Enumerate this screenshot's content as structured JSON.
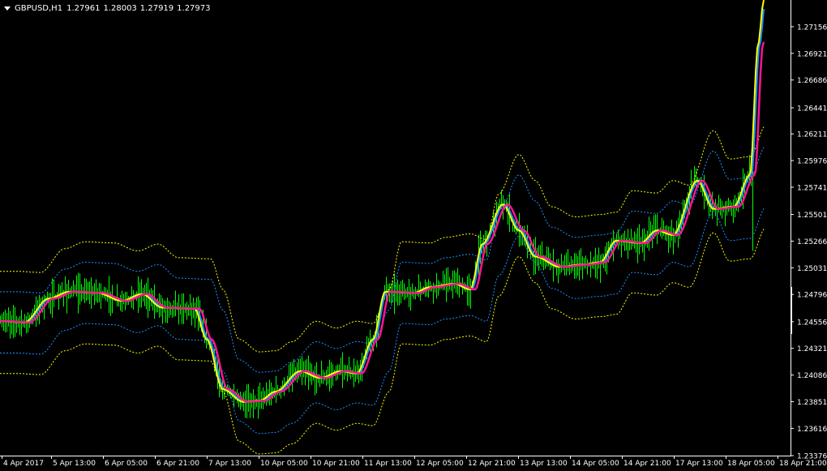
{
  "header": {
    "symbol": "GBPUSD,H1",
    "open": "1.27961",
    "high": "1.28003",
    "low": "1.27919",
    "close": "1.27973"
  },
  "colors": {
    "background": "#000000",
    "axis": "#ffffff",
    "candles": "#00ff00",
    "ma_cyan": "#1e90ff",
    "ma_yellow": "#ffff00",
    "ma_magenta": "#ff1493",
    "band_yellow": "#ffff00",
    "band_blue": "#1e90ff"
  },
  "chart_data": {
    "type": "line",
    "title": "",
    "xlabel": "",
    "ylabel": "",
    "ylim": [
      1.23376,
      1.27391
    ],
    "y_ticks": [
      "1.27156",
      "1.26921",
      "1.26686",
      "1.26441",
      "1.26211",
      "1.25976",
      "1.25741",
      "1.25501",
      "1.25266",
      "1.25031",
      "1.24796",
      "1.24556",
      "1.24321",
      "1.24086",
      "1.23851",
      "1.23616",
      "1.23376"
    ],
    "x_ticks": [
      "4 Apr 2017",
      "5 Apr 13:00",
      "6 Apr 05:00",
      "6 Apr 21:00",
      "7 Apr 13:00",
      "10 Apr 05:00",
      "10 Apr 21:00",
      "11 Apr 13:00",
      "12 Apr 05:00",
      "12 Apr 21:00",
      "13 Apr 13:00",
      "14 Apr 05:00",
      "14 Apr 21:00",
      "17 Apr 13:00",
      "18 Apr 05:00",
      "18 Apr 21:00"
    ],
    "x": [
      0,
      1,
      2,
      3,
      4,
      5,
      6,
      7,
      8,
      9,
      10,
      11,
      12,
      13,
      14,
      15,
      16,
      17,
      18,
      19,
      20,
      21,
      22,
      23,
      24,
      25,
      26,
      27,
      28,
      29,
      30,
      31,
      32,
      33,
      34,
      35,
      36,
      37,
      38,
      39,
      40,
      41,
      42,
      43,
      44,
      45,
      46,
      47,
      48,
      49,
      50,
      51,
      52,
      53,
      54,
      55,
      56,
      57,
      58,
      59,
      60,
      61,
      62,
      63,
      64,
      65,
      66,
      67,
      68,
      69,
      70,
      71,
      72,
      73,
      74,
      75,
      76,
      77,
      78,
      79,
      80,
      81,
      82,
      83,
      84,
      85,
      86,
      87,
      88,
      89,
      90,
      91,
      92,
      93,
      94,
      95,
      96,
      97,
      98,
      99,
      100,
      101,
      102,
      103,
      104,
      105,
      106,
      107,
      108,
      109,
      110,
      111,
      112,
      113,
      114,
      115,
      116,
      117,
      118,
      119,
      120,
      121,
      122,
      123,
      124,
      125,
      126,
      127,
      128,
      129,
      130,
      131,
      132,
      133,
      134,
      135,
      136,
      137,
      138,
      139,
      140,
      141,
      142,
      143,
      144,
      145,
      146,
      147,
      148,
      149,
      150,
      151,
      152,
      153,
      154,
      155,
      156,
      157,
      158,
      159,
      160,
      161,
      162,
      163,
      164,
      165,
      166,
      167,
      168,
      169,
      170,
      171,
      172,
      173,
      174,
      175,
      176,
      177,
      178,
      179,
      180,
      181,
      182,
      183,
      184,
      185,
      186,
      187,
      188,
      189,
      190,
      191,
      192,
      193,
      194,
      195,
      196,
      197,
      198,
      199,
      200,
      201,
      202,
      203,
      204,
      205,
      206,
      207,
      208,
      209,
      210,
      211,
      212,
      213,
      214,
      215,
      216,
      217,
      218,
      219,
      220,
      221,
      222,
      223,
      224,
      225,
      226,
      227,
      228,
      229,
      230,
      231,
      232,
      233,
      234,
      235,
      236,
      237,
      238,
      239,
      240,
      241,
      242,
      243,
      244,
      245,
      246,
      247,
      248,
      249,
      250,
      251,
      252,
      253,
      254,
      255,
      256,
      257,
      258,
      259,
      260,
      261,
      262,
      263,
      264,
      265,
      266,
      267,
      268,
      269,
      270,
      271,
      272,
      273,
      274,
      275,
      276,
      277,
      278,
      279,
      280,
      281,
      282,
      283,
      284,
      285,
      286,
      287,
      288,
      289,
      290,
      291,
      292,
      293,
      294,
      295,
      296,
      297,
      298,
      299,
      300,
      301,
      302,
      303,
      304,
      305,
      306,
      307,
      308,
      309,
      310,
      311,
      312,
      313,
      314,
      315,
      316,
      317,
      318,
      319,
      320,
      321,
      322,
      323,
      324,
      325,
      326,
      327,
      328,
      329,
      330,
      331,
      332,
      333,
      334,
      335,
      336,
      337,
      338,
      339,
      340,
      341,
      342,
      343,
      344,
      345,
      346,
      347,
      348,
      349,
      350,
      351,
      352,
      353,
      354,
      355,
      356,
      357,
      358,
      359,
      360,
      361,
      362,
      363,
      364,
      365,
      366,
      367,
      368,
      369,
      370,
      371,
      372,
      373,
      374,
      375,
      376,
      377,
      378,
      379,
      380,
      381,
      382,
      383,
      384,
      385,
      386,
      387,
      388,
      389,
      390,
      391,
      392,
      393,
      394,
      395,
      396,
      397,
      398,
      399,
      400,
      401,
      402,
      403,
      404,
      405,
      406,
      407,
      408,
      409,
      410,
      411,
      412,
      413,
      414,
      415,
      416,
      417,
      418,
      419,
      420,
      421,
      422,
      423,
      424,
      425,
      426,
      427,
      428,
      429,
      430,
      431,
      432,
      433,
      434,
      435,
      436,
      437,
      438,
      439,
      440,
      441,
      442,
      443,
      444,
      445,
      446,
      447,
      448,
      449,
      450,
      451,
      452,
      453,
      454,
      455,
      456,
      457,
      458,
      459,
      460,
      461,
      462,
      463,
      464,
      465,
      466,
      467,
      468,
      469,
      470,
      471,
      472,
      473,
      474,
      475,
      476,
      477,
      478,
      479,
      480,
      481,
      482,
      483,
      484,
      485,
      486,
      487,
      488,
      489,
      490,
      491,
      492,
      493,
      494,
      495,
      496,
      497,
      498,
      499,
      500,
      501,
      502,
      503,
      504,
      505,
      506,
      507,
      508,
      509,
      510,
      511,
      512,
      513,
      514,
      515,
      516,
      517,
      518,
      519,
      520,
      521,
      522,
      523,
      524,
      525,
      526,
      527,
      528,
      529,
      530,
      531,
      532,
      533,
      534,
      535,
      536,
      537,
      538,
      539,
      540,
      541,
      542,
      543,
      544,
      545,
      546,
      547,
      548,
      549,
      550,
      551,
      552,
      553,
      554,
      555,
      556,
      557,
      558,
      559,
      560,
      561,
      562,
      563,
      564,
      565,
      566,
      567,
      568,
      569,
      570,
      571,
      572,
      573,
      574,
      575,
      576,
      577,
      578,
      579,
      580,
      581,
      582,
      583,
      584,
      585,
      586,
      587,
      588,
      589,
      590,
      591,
      592,
      593,
      594,
      595,
      596,
      597,
      598,
      599,
      600,
      601,
      602,
      603,
      604,
      605,
      606,
      607,
      608,
      609,
      610,
      611,
      612,
      613,
      614,
      615,
      616,
      617,
      618,
      619,
      620,
      621,
      622,
      623,
      624,
      625,
      626,
      627,
      628,
      629,
      630,
      631,
      632,
      633,
      634,
      635,
      636,
      637,
      638,
      639,
      640,
      641,
      642,
      643,
      644,
      645,
      646,
      647,
      648,
      649,
      650,
      651,
      652,
      653,
      654,
      655,
      656,
      657,
      658,
      659,
      660,
      661,
      662,
      663,
      664,
      665,
      666,
      667,
      668,
      669,
      670,
      671,
      672,
      673,
      674,
      675,
      676,
      677,
      678,
      679,
      680,
      681,
      682,
      683,
      684,
      685,
      686,
      687,
      688,
      689,
      690,
      691,
      692,
      693,
      694,
      695,
      696,
      697,
      698,
      699,
      700,
      701,
      702,
      703,
      704,
      705,
      706,
      707,
      708,
      709,
      710,
      711,
      712,
      713,
      714,
      715,
      716,
      717,
      718,
      719,
      720,
      721,
      722,
      723,
      724,
      725,
      726,
      727,
      728,
      729,
      730,
      731,
      732,
      733,
      734,
      735,
      736,
      737,
      738,
      739,
      740,
      741,
      742,
      743,
      744,
      745,
      746,
      747,
      748,
      749,
      750,
      751,
      752,
      753,
      754,
      755,
      756,
      757,
      758,
      759,
      760,
      761,
      762,
      763,
      764,
      765,
      766,
      767,
      768,
      769,
      770,
      771,
      772,
      773,
      774,
      775,
      776,
      777,
      778,
      779,
      780,
      781,
      782,
      783,
      784,
      785,
      786,
      787,
      788,
      789,
      790,
      791,
      792,
      793,
      794,
      795,
      796,
      797,
      798,
      799,
      800,
      801,
      802,
      803,
      804,
      805,
      806,
      807,
      808,
      809,
      810,
      811,
      812,
      813,
      814,
      815,
      816,
      817,
      818,
      819,
      820,
      821,
      822,
      823,
      824,
      825,
      826,
      827,
      828,
      829,
      830,
      831,
      832,
      833,
      834,
      835,
      836,
      837,
      838,
      839,
      840,
      841,
      842,
      843,
      844,
      845,
      846,
      847,
      848,
      849,
      850,
      851,
      852,
      853,
      854,
      855,
      856,
      857,
      858,
      859,
      860,
      861,
      862,
      863,
      864,
      865,
      866,
      867,
      868,
      869,
      870,
      871,
      872,
      873,
      874,
      875,
      876,
      877,
      878,
      879,
      880,
      881,
      882,
      883,
      884,
      885,
      886,
      887,
      888,
      889,
      890,
      891,
      892,
      893,
      894,
      895,
      896,
      897,
      898,
      899,
      900,
      901,
      902,
      903,
      904,
      905,
      906,
      907,
      908,
      909,
      910,
      911,
      912,
      913,
      914,
      915,
      916,
      917,
      918,
      919,
      920,
      921,
      922,
      923,
      924,
      925,
      926,
      927,
      928,
      929,
      930,
      931,
      932,
      933,
      934,
      935,
      936,
      937,
      938,
      939,
      940,
      941,
      942,
      943,
      944,
      945,
      946,
      947,
      948,
      949,
      950,
      951,
      952,
      953,
      954,
      955,
      956,
      957,
      958,
      959,
      960,
      961,
      962,
      963,
      964,
      965,
      966,
      967,
      968,
      969,
      970,
      971,
      972,
      973,
      974,
      975
    ],
    "key_points": [
      [
        0,
        1.2456
      ],
      [
        30,
        1.2455
      ],
      [
        60,
        1.2476
      ],
      [
        85,
        1.2482
      ],
      [
        120,
        1.2481
      ],
      [
        150,
        1.2474
      ],
      [
        175,
        1.248
      ],
      [
        200,
        1.2468
      ],
      [
        240,
        1.2467
      ],
      [
        255,
        1.244
      ],
      [
        275,
        1.2396
      ],
      [
        300,
        1.2385
      ],
      [
        320,
        1.2386
      ],
      [
        340,
        1.2394
      ],
      [
        370,
        1.2412
      ],
      [
        395,
        1.2406
      ],
      [
        420,
        1.2412
      ],
      [
        440,
        1.241
      ],
      [
        460,
        1.244
      ],
      [
        475,
        1.2482
      ],
      [
        510,
        1.2481
      ],
      [
        530,
        1.2486
      ],
      [
        560,
        1.2489
      ],
      [
        580,
        1.2484
      ],
      [
        595,
        1.2524
      ],
      [
        620,
        1.2559
      ],
      [
        640,
        1.2536
      ],
      [
        660,
        1.2513
      ],
      [
        690,
        1.2504
      ],
      [
        720,
        1.2506
      ],
      [
        740,
        1.2508
      ],
      [
        760,
        1.2527
      ],
      [
        790,
        1.2525
      ],
      [
        810,
        1.2536
      ],
      [
        830,
        1.2532
      ],
      [
        860,
        1.258
      ],
      [
        880,
        1.2555
      ],
      [
        905,
        1.2557
      ],
      [
        925,
        1.2585
      ],
      [
        935,
        1.27
      ],
      [
        942,
        1.2739
      ]
    ],
    "series": [
      {
        "name": "",
        "role": "close_line",
        "color": "#ffff00"
      },
      {
        "name": "",
        "role": "fast_ma",
        "color": "#1e90ff"
      },
      {
        "name": "",
        "role": "slow_ma",
        "color": "#ff1493"
      }
    ],
    "bands": {
      "upper_outer_offset": 0.0044,
      "upper_inner_offset": 0.0026,
      "lower_inner_offset": -0.0028,
      "lower_outer_offset": -0.0046
    },
    "grid": false,
    "legend": "none"
  }
}
